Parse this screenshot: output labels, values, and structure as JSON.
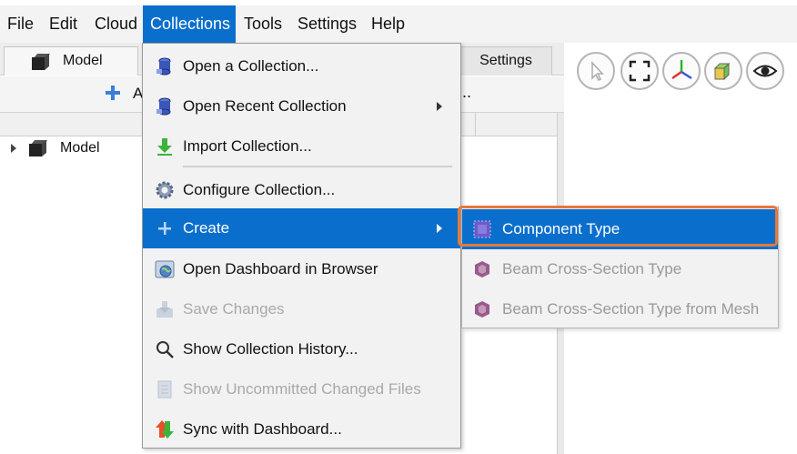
{
  "menubar": {
    "items": [
      {
        "label": "File"
      },
      {
        "label": "Edit"
      },
      {
        "label": "Cloud"
      },
      {
        "label": "Collections"
      },
      {
        "label": "Tools"
      },
      {
        "label": "Settings"
      },
      {
        "label": "Help"
      }
    ]
  },
  "left_panel": {
    "tabs": [
      {
        "label": "Model"
      },
      {
        "label": "Settings"
      }
    ],
    "toolbar_fragment": "A",
    "toolbar_ellipsis": "...",
    "tree": [
      {
        "label": "Model"
      }
    ]
  },
  "right_toolbar": {
    "buttons": [
      "select-cursor-icon",
      "fit-view-icon",
      "axes-icon",
      "box-view-icon",
      "eye-icon"
    ]
  },
  "collections_menu": {
    "items": [
      {
        "label": "Open a Collection...",
        "icon": "collection-icon",
        "enabled": true
      },
      {
        "label": "Open Recent Collection",
        "icon": "collection-icon",
        "enabled": true,
        "submenu": true
      },
      {
        "label": "Import Collection...",
        "icon": "import-arrow-icon",
        "enabled": true
      },
      {
        "label": "Configure Collection...",
        "icon": "gear-icon",
        "enabled": true
      },
      {
        "label": "Create",
        "icon": "plus-icon",
        "enabled": true,
        "submenu": true,
        "highlighted": true
      },
      {
        "label": "Open Dashboard in Browser",
        "icon": "globe-icon",
        "enabled": true
      },
      {
        "label": "Save Changes",
        "icon": "save-icon",
        "enabled": false
      },
      {
        "label": "Show Collection History...",
        "icon": "magnifier-icon",
        "enabled": true
      },
      {
        "label": "Show Uncommitted Changed Files",
        "icon": "document-icon",
        "enabled": false
      },
      {
        "label": "Sync with Dashboard...",
        "icon": "sync-arrows-icon",
        "enabled": true
      }
    ]
  },
  "create_submenu": {
    "items": [
      {
        "label": "Component Type",
        "icon": "component-type-icon",
        "enabled": true,
        "highlighted": true
      },
      {
        "label": "Beam Cross-Section Type",
        "icon": "beam-section-icon",
        "enabled": false
      },
      {
        "label": "Beam Cross-Section Type from Mesh",
        "icon": "beam-section-icon",
        "enabled": false
      }
    ]
  },
  "colors": {
    "highlight": "#0a6fcc",
    "callout": "#e8773a"
  }
}
